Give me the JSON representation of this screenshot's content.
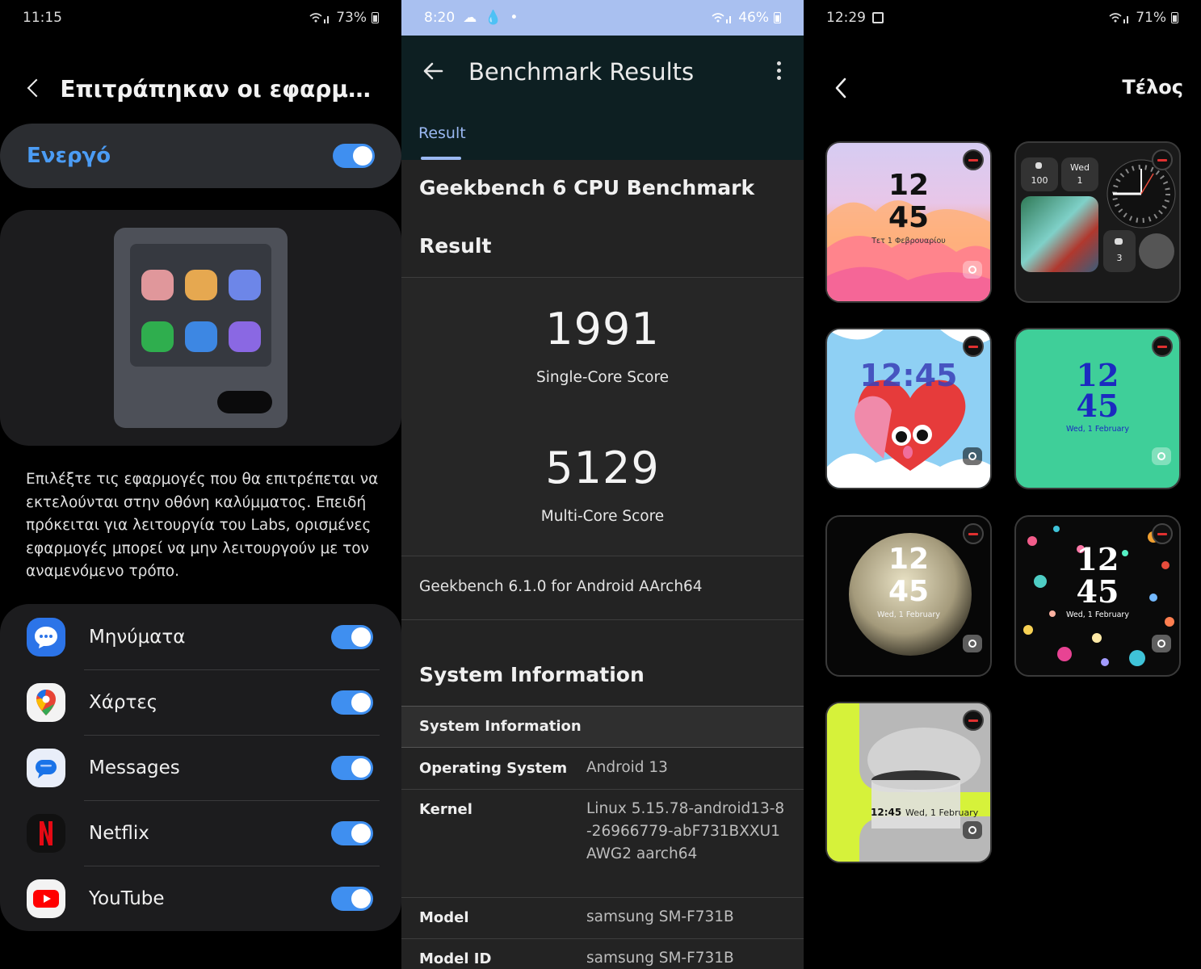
{
  "panel1": {
    "status": {
      "time": "11:15",
      "battery": "73%"
    },
    "title": "Επιτράπηκαν οι εφαρμογές...",
    "master_toggle": {
      "label": "Ενεργό",
      "on": true
    },
    "description": "Επιλέξτε τις εφαρμογές που θα επιτρέπεται να εκτελούνται στην οθόνη καλύμματος. Επειδή πρόκειται για λειτουργία του Labs, ορισμένες εφαρμογές μπορεί να μην λειτουργούν με τον αναμενόμενο τρόπο.",
    "apps": [
      {
        "name": "Μηνύματα",
        "icon": "samsung-messages-icon",
        "on": true
      },
      {
        "name": "Χάρτες",
        "icon": "google-maps-icon",
        "on": true
      },
      {
        "name": "Messages",
        "icon": "google-messages-icon",
        "on": true
      },
      {
        "name": "Netflix",
        "icon": "netflix-icon",
        "on": true
      },
      {
        "name": "YouTube",
        "icon": "youtube-icon",
        "on": true
      }
    ],
    "colors": {
      "accent": "#3f8ff0",
      "card": "#1c1c1e"
    }
  },
  "panel2": {
    "status": {
      "time": "8:20",
      "battery": "46%"
    },
    "title": "Benchmark Results",
    "tab": "Result",
    "benchmark_title": "Geekbench 6 CPU Benchmark",
    "result_heading": "Result",
    "single_core": {
      "score": "1991",
      "label": "Single-Core Score"
    },
    "multi_core": {
      "score": "5129",
      "label": "Multi-Core Score"
    },
    "version": "Geekbench 6.1.0 for Android AArch64",
    "system_heading": "System Information",
    "system_table_heading": "System Information",
    "rows": [
      {
        "key": "Operating System",
        "value": "Android 13"
      },
      {
        "key": "Kernel",
        "value": "Linux 5.15.78-android13-8-26966779-abF731BXXU1AWG2 aarch64"
      },
      {
        "key": "Model",
        "value": "samsung SM-F731B"
      },
      {
        "key": "Model ID",
        "value": "samsung SM-F731B"
      }
    ]
  },
  "panel3": {
    "status": {
      "time": "12:29",
      "battery": "71%"
    },
    "done_label": "Τέλος",
    "tiles": [
      {
        "hour": "12",
        "minute": "45",
        "date": "Τετ 1 Φεβρουαρίου"
      },
      {
        "steps": "100",
        "day": "Wed",
        "day_num": "1",
        "count": "3"
      },
      {
        "time": "12:45"
      },
      {
        "hour": "12",
        "minute": "45",
        "date": "Wed, 1 February"
      },
      {
        "hour": "12",
        "minute": "45",
        "date": "Wed, 1 February"
      },
      {
        "hour": "12",
        "minute": "45",
        "date": "Wed, 1 February"
      },
      {
        "time": "12:45",
        "date": "Wed, 1 February"
      }
    ]
  }
}
